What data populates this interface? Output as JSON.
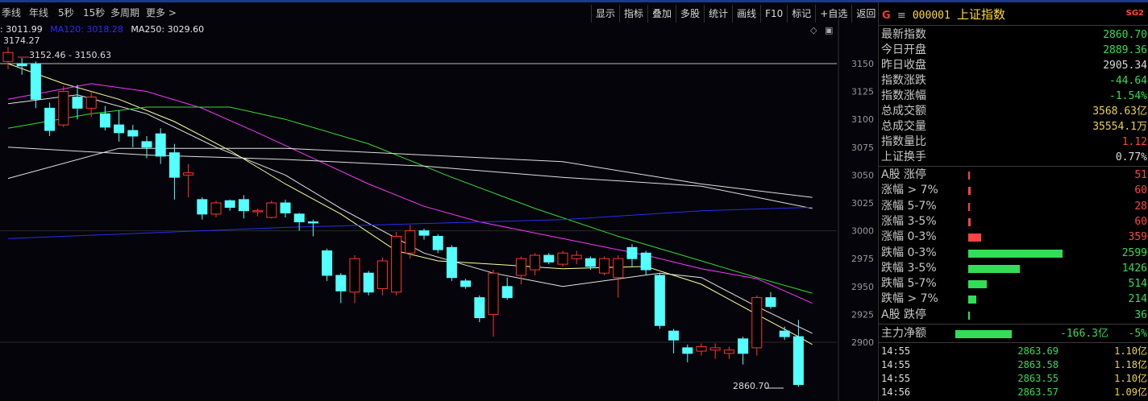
{
  "period_tabs": [
    "季线",
    "年线",
    "5秒",
    "15秒",
    "多周期",
    "更多 >"
  ],
  "toolbar": [
    "显示",
    "指标",
    "叠加",
    "多股",
    "统计",
    "画线",
    "F10",
    "标记",
    "+自选",
    "返回"
  ],
  "ma_legend": [
    {
      "text": ": 3011.99",
      "color": "#e8e8e8"
    },
    {
      "text": "MA120: 3018.28",
      "color": "#2c2cf0"
    },
    {
      "text": "MA250: 3029.60",
      "color": "#e8e8e8"
    }
  ],
  "annotations": {
    "high_label": "3174.27",
    "range_label": "3152.46 - 3150.63",
    "last_label": "2860.70"
  },
  "chart_data": {
    "type": "candlestick",
    "y_ticks": [
      3150,
      3125,
      3100,
      3075,
      3050,
      3025,
      3000,
      2975,
      2950,
      2925,
      2900
    ],
    "ylim": [
      2855,
      3175
    ],
    "candles": [
      [
        3152,
        3160,
        3145,
        3165
      ],
      [
        3150,
        3148,
        3140,
        3155
      ],
      [
        3150,
        3118,
        3110,
        3152
      ],
      [
        3110,
        3090,
        3085,
        3115
      ],
      [
        3095,
        3125,
        3093,
        3130
      ],
      [
        3120,
        3110,
        3100,
        3131
      ],
      [
        3110,
        3120,
        3102,
        3125
      ],
      [
        3105,
        3093,
        3090,
        3112
      ],
      [
        3095,
        3088,
        3080,
        3108
      ],
      [
        3090,
        3085,
        3075,
        3095
      ],
      [
        3080,
        3075,
        3065,
        3085
      ],
      [
        3087,
        3067,
        3060,
        3092
      ],
      [
        3070,
        3048,
        3028,
        3078
      ],
      [
        3050,
        3052,
        3030,
        3060
      ],
      [
        3028,
        3015,
        3010,
        3030
      ],
      [
        3015,
        3025,
        3012,
        3027
      ],
      [
        3027,
        3021,
        3018,
        3028
      ],
      [
        3028,
        3018,
        3011,
        3032
      ],
      [
        3017,
        3018,
        3013,
        3020
      ],
      [
        3012,
        3025,
        3011,
        3027
      ],
      [
        3025,
        3016,
        3012,
        3028
      ],
      [
        3015,
        3008,
        3000,
        3016
      ],
      [
        3008,
        3007,
        2995,
        3010
      ],
      [
        2982,
        2960,
        2955,
        2984
      ],
      [
        2960,
        2946,
        2935,
        2962
      ],
      [
        2945,
        2975,
        2935,
        2978
      ],
      [
        2962,
        2945,
        2942,
        2964
      ],
      [
        2948,
        2973,
        2942,
        2976
      ],
      [
        2945,
        2995,
        2942,
        2999
      ],
      [
        2980,
        3000,
        2975,
        3005
      ],
      [
        3000,
        2996,
        2992,
        3002
      ],
      [
        2995,
        2983,
        2980,
        2997
      ],
      [
        2985,
        2958,
        2955,
        2987
      ],
      [
        2955,
        2950,
        2948,
        2957
      ],
      [
        2940,
        2922,
        2918,
        2942
      ],
      [
        2925,
        2962,
        2905,
        2965
      ],
      [
        2950,
        2940,
        2938,
        2958
      ],
      [
        2960,
        2975,
        2952,
        2977
      ],
      [
        2965,
        2978,
        2960,
        2980
      ],
      [
        2978,
        2972,
        2970,
        2980
      ],
      [
        2970,
        2980,
        2968,
        2982
      ],
      [
        2975,
        2978,
        2970,
        2982
      ],
      [
        2975,
        2968,
        2965,
        2977
      ],
      [
        2962,
        2975,
        2960,
        2977
      ],
      [
        2958,
        2975,
        2940,
        2978
      ],
      [
        2985,
        2975,
        2968,
        2988
      ],
      [
        2980,
        2965,
        2960,
        2982
      ],
      [
        2960,
        2915,
        2912,
        2962
      ],
      [
        2910,
        2902,
        2890,
        2912
      ],
      [
        2895,
        2890,
        2882,
        2898
      ],
      [
        2892,
        2896,
        2888,
        2899
      ],
      [
        2893,
        2895,
        2885,
        2899
      ],
      [
        2890,
        2893,
        2885,
        2896
      ],
      [
        2903,
        2890,
        2880,
        2905
      ],
      [
        2895,
        2940,
        2888,
        2942
      ],
      [
        2940,
        2932,
        2930,
        2945
      ],
      [
        2910,
        2905,
        2902,
        2914
      ],
      [
        2905,
        2862,
        2860,
        2920
      ]
    ],
    "ma_lines": [
      {
        "color": "#e6e6e6",
        "points": [
          [
            0,
            3114
          ],
          [
            5,
            3122
          ],
          [
            10,
            3105
          ],
          [
            15,
            3075
          ],
          [
            20,
            3050
          ],
          [
            24,
            3020
          ],
          [
            30,
            2980
          ],
          [
            35,
            2962
          ],
          [
            40,
            2950
          ],
          [
            47,
            2962
          ],
          [
            50,
            2958
          ],
          [
            54,
            2932
          ],
          [
            58,
            2908
          ]
        ]
      },
      {
        "color": "#ffff9c",
        "points": [
          [
            0,
            3150
          ],
          [
            4,
            3132
          ],
          [
            8,
            3118
          ],
          [
            12,
            3098
          ],
          [
            16,
            3072
          ],
          [
            20,
            3042
          ],
          [
            24,
            3015
          ],
          [
            28,
            2982
          ],
          [
            31,
            2973
          ],
          [
            35,
            2970
          ],
          [
            40,
            2966
          ],
          [
            46,
            2968
          ],
          [
            50,
            2952
          ],
          [
            54,
            2925
          ],
          [
            57,
            2905
          ],
          [
            58,
            2898
          ]
        ]
      },
      {
        "color": "#ff33ff",
        "points": [
          [
            0,
            3118
          ],
          [
            6,
            3132
          ],
          [
            10,
            3125
          ],
          [
            14,
            3110
          ],
          [
            18,
            3088
          ],
          [
            22,
            3065
          ],
          [
            26,
            3042
          ],
          [
            30,
            3022
          ],
          [
            34,
            3008
          ],
          [
            40,
            2993
          ],
          [
            46,
            2978
          ],
          [
            50,
            2966
          ],
          [
            54,
            2957
          ],
          [
            58,
            2935
          ]
        ]
      },
      {
        "color": "#33dd33",
        "points": [
          [
            0,
            3092
          ],
          [
            6,
            3105
          ],
          [
            10,
            3111
          ],
          [
            16,
            3111
          ],
          [
            20,
            3100
          ],
          [
            26,
            3078
          ],
          [
            32,
            3048
          ],
          [
            38,
            3020
          ],
          [
            44,
            2995
          ],
          [
            50,
            2973
          ],
          [
            54,
            2958
          ],
          [
            58,
            2944
          ]
        ]
      },
      {
        "color": "#e0e0e0",
        "points": [
          [
            0,
            3075
          ],
          [
            10,
            3068
          ],
          [
            20,
            3064
          ],
          [
            30,
            3058
          ],
          [
            40,
            3048
          ],
          [
            50,
            3040
          ],
          [
            58,
            3020
          ]
        ]
      },
      {
        "color": "#e0e0e0",
        "points": [
          [
            0,
            3047
          ],
          [
            8,
            3074
          ],
          [
            20,
            3074
          ],
          [
            30,
            3068
          ],
          [
            40,
            3062
          ],
          [
            50,
            3042
          ],
          [
            58,
            3030
          ]
        ]
      },
      {
        "color": "#2c2cf0",
        "points": [
          [
            0,
            2993
          ],
          [
            20,
            3003
          ],
          [
            40,
            3010
          ],
          [
            50,
            3018
          ],
          [
            58,
            3021
          ]
        ]
      }
    ]
  },
  "panel": {
    "header": {
      "code": "000001",
      "name": "上证指数",
      "marker_g": "G",
      "menu": "≡",
      "badge": "SG2"
    },
    "stats": [
      {
        "label": "最新指数",
        "value": "2860.70",
        "color": "#33dd55"
      },
      {
        "label": "今日开盘",
        "value": "2889.36",
        "color": "#33dd55"
      },
      {
        "label": "昨日收盘",
        "value": "2905.34",
        "color": "#d8d8d8"
      },
      {
        "label": "指数涨跌",
        "value": "-44.64",
        "color": "#33dd55"
      },
      {
        "label": "指数涨幅",
        "value": "-1.54%",
        "color": "#33dd55"
      },
      {
        "label": "总成交额",
        "value": "3568.63亿",
        "color": "#e8d24a"
      },
      {
        "label": "总成交量",
        "value": "35554.1万",
        "color": "#e8d24a"
      },
      {
        "label": "指数量比",
        "value": "1.12",
        "color": "#ff4444"
      },
      {
        "label": "上证换手",
        "value": "0.77%",
        "color": "#d8d8d8"
      }
    ],
    "breadth": [
      {
        "label": "A股 涨停",
        "value": "51",
        "color": "#ff4444",
        "share": 0.02
      },
      {
        "label": "涨幅 > 7%",
        "value": "60",
        "color": "#ff4444",
        "share": 0.023
      },
      {
        "label": "涨幅 5-7%",
        "value": "28",
        "color": "#ff4444",
        "share": 0.011
      },
      {
        "label": "涨幅 3-5%",
        "value": "60",
        "color": "#ff4444",
        "share": 0.023
      },
      {
        "label": "涨幅 0-3%",
        "value": "359",
        "color": "#ff4444",
        "share": 0.138
      },
      {
        "label": "跌幅 0-3%",
        "value": "2599",
        "color": "#33dd55",
        "share": 1.0
      },
      {
        "label": "跌幅 3-5%",
        "value": "1426",
        "color": "#33dd55",
        "share": 0.549
      },
      {
        "label": "跌幅 5-7%",
        "value": "514",
        "color": "#33dd55",
        "share": 0.198
      },
      {
        "label": "跌幅 > 7%",
        "value": "214",
        "color": "#33dd55",
        "share": 0.082
      },
      {
        "label": "A股 跌停",
        "value": "36",
        "color": "#33dd55",
        "share": 0.014
      }
    ],
    "net_flow": {
      "label": "主力净额",
      "value": "-166.3亿",
      "pct": "-5%",
      "color": "#33dd55",
      "share": 0.7
    },
    "ticks": [
      {
        "time": "14:55",
        "price": "2863.69",
        "amount": "1.10亿"
      },
      {
        "time": "14:55",
        "price": "2863.58",
        "amount": "1.18亿"
      },
      {
        "time": "14:55",
        "price": "2863.55",
        "amount": "1.10亿"
      },
      {
        "time": "14:56",
        "price": "2863.57",
        "amount": "1.09亿"
      }
    ]
  }
}
